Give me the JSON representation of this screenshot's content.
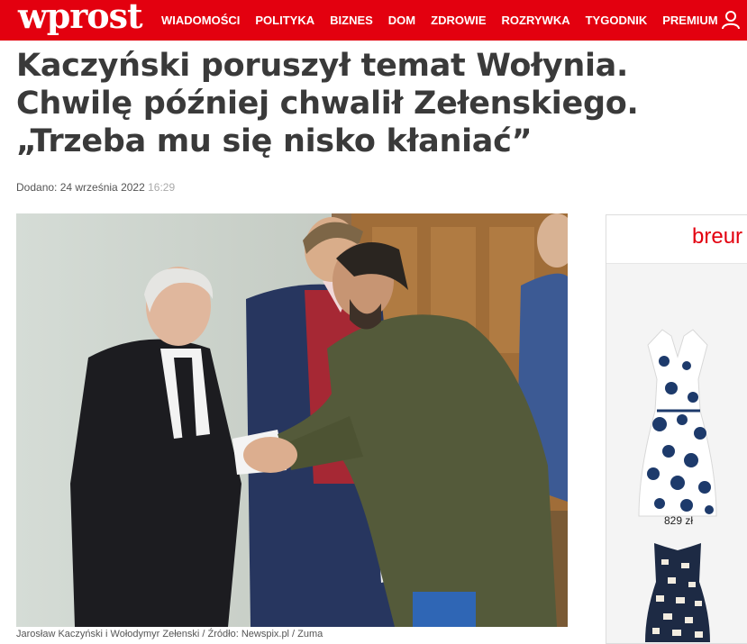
{
  "header": {
    "logo": "wprost",
    "nav": [
      "WIADOMOŚCI",
      "POLITYKA",
      "BIZNES",
      "DOM",
      "ZDROWIE",
      "ROZRYWKA",
      "TYGODNIK",
      "PREMIUM"
    ],
    "brand_color": "#e3000f"
  },
  "article": {
    "title": "Kaczyński poruszył temat Wołynia. Chwilę później chwalił Zełenskiego. „Trzeba mu się nisko kłaniać”",
    "date_label": "Dodano: 24 września 2022",
    "time": "16:29",
    "caption": "Jarosław Kaczyński i Wołodymyr Zełenski / Źródło: Newspix.pl / Zuma"
  },
  "ad": {
    "brand": "breur",
    "price": "829 zł"
  }
}
